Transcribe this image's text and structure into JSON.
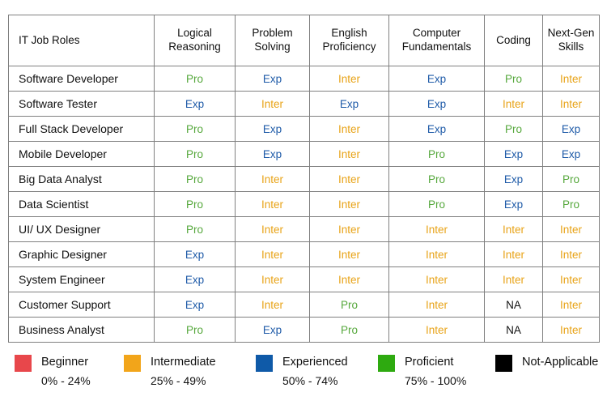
{
  "table": {
    "columns": [
      {
        "label": "IT Job Roles",
        "lines": [
          "IT Job Roles"
        ]
      },
      {
        "label": "Logical Reasoning",
        "lines": [
          "Logical",
          "Reasoning"
        ]
      },
      {
        "label": "Problem Solving",
        "lines": [
          "Problem",
          "Solving"
        ]
      },
      {
        "label": "English Proficiency",
        "lines": [
          "English",
          "Proficiency"
        ]
      },
      {
        "label": "Computer Fundamentals",
        "lines": [
          "Computer",
          "Fundamentals"
        ]
      },
      {
        "label": "Coding",
        "lines": [
          "Coding"
        ]
      },
      {
        "label": "Next-Gen Skills",
        "lines": [
          "Next-Gen",
          "Skills"
        ]
      }
    ],
    "rows": [
      {
        "role": "Software Developer",
        "values": [
          "Pro",
          "Exp",
          "Inter",
          "Exp",
          "Pro",
          "Inter"
        ]
      },
      {
        "role": "Software Tester",
        "values": [
          "Exp",
          "Inter",
          "Exp",
          "Exp",
          "Inter",
          "Inter"
        ]
      },
      {
        "role": "Full Stack Developer",
        "values": [
          "Pro",
          "Exp",
          "Inter",
          "Exp",
          "Pro",
          "Exp"
        ]
      },
      {
        "role": "Mobile Developer",
        "values": [
          "Pro",
          "Exp",
          "Inter",
          "Pro",
          "Exp",
          "Exp"
        ]
      },
      {
        "role": "Big Data Analyst",
        "values": [
          "Pro",
          "Inter",
          "Inter",
          "Pro",
          "Exp",
          "Pro"
        ]
      },
      {
        "role": "Data Scientist",
        "values": [
          "Pro",
          "Inter",
          "Inter",
          "Pro",
          "Exp",
          "Pro"
        ]
      },
      {
        "role": "UI/ UX Designer",
        "values": [
          "Pro",
          "Inter",
          "Inter",
          "Inter",
          "Inter",
          "Inter"
        ]
      },
      {
        "role": "Graphic Designer",
        "values": [
          "Exp",
          "Inter",
          "Inter",
          "Inter",
          "Inter",
          "Inter"
        ]
      },
      {
        "role": "System Engineer",
        "values": [
          "Exp",
          "Inter",
          "Inter",
          "Inter",
          "Inter",
          "Inter"
        ]
      },
      {
        "role": "Customer Support",
        "values": [
          "Exp",
          "Inter",
          "Pro",
          "Inter",
          "NA",
          "Inter"
        ]
      },
      {
        "role": "Business Analyst",
        "values": [
          "Pro",
          "Exp",
          "Pro",
          "Inter",
          "NA",
          "Inter"
        ]
      }
    ]
  },
  "legend": {
    "items": [
      {
        "label": "Beginner",
        "range": "0% - 24%",
        "color": "#e8474b"
      },
      {
        "label": "Intermediate",
        "range": "25% - 49%",
        "color": "#f2a51a"
      },
      {
        "label": "Experienced",
        "range": "50% - 74%",
        "color": "#0f5aa8"
      },
      {
        "label": "Proficient",
        "range": "75% - 100%",
        "color": "#2eaa10"
      },
      {
        "label": "Not-Applicable",
        "range": "",
        "color": "#000000"
      }
    ]
  },
  "value_colors": {
    "Pro": "#56a83c",
    "Exp": "#1f5ba8",
    "Inter": "#e8a317",
    "NA": "#111111"
  },
  "chart_data": {
    "type": "table",
    "title": "",
    "categories": [
      "Logical Reasoning",
      "Problem Solving",
      "English Proficiency",
      "Computer Fundamentals",
      "Coding",
      "Next-Gen Skills"
    ],
    "row_labels": [
      "Software Developer",
      "Software Tester",
      "Full Stack Developer",
      "Mobile Developer",
      "Big Data Analyst",
      "Data Scientist",
      "UI/ UX Designer",
      "Graphic Designer",
      "System Engineer",
      "Customer Support",
      "Business Analyst"
    ],
    "cells": [
      [
        "Pro",
        "Exp",
        "Inter",
        "Exp",
        "Pro",
        "Inter"
      ],
      [
        "Exp",
        "Inter",
        "Exp",
        "Exp",
        "Inter",
        "Inter"
      ],
      [
        "Pro",
        "Exp",
        "Inter",
        "Exp",
        "Pro",
        "Exp"
      ],
      [
        "Pro",
        "Exp",
        "Inter",
        "Pro",
        "Exp",
        "Exp"
      ],
      [
        "Pro",
        "Inter",
        "Inter",
        "Pro",
        "Exp",
        "Pro"
      ],
      [
        "Pro",
        "Inter",
        "Inter",
        "Pro",
        "Exp",
        "Pro"
      ],
      [
        "Pro",
        "Inter",
        "Inter",
        "Inter",
        "Inter",
        "Inter"
      ],
      [
        "Exp",
        "Inter",
        "Inter",
        "Inter",
        "Inter",
        "Inter"
      ],
      [
        "Exp",
        "Inter",
        "Inter",
        "Inter",
        "Inter",
        "Inter"
      ],
      [
        "Exp",
        "Inter",
        "Pro",
        "Inter",
        "NA",
        "Inter"
      ],
      [
        "Pro",
        "Exp",
        "Pro",
        "Inter",
        "NA",
        "Inter"
      ]
    ],
    "legend_entries": [
      {
        "code": "Beg",
        "label": "Beginner",
        "range": "0% - 24%"
      },
      {
        "code": "Inter",
        "label": "Intermediate",
        "range": "25% - 49%"
      },
      {
        "code": "Exp",
        "label": "Experienced",
        "range": "50% - 74%"
      },
      {
        "code": "Pro",
        "label": "Proficient",
        "range": "75% - 100%"
      },
      {
        "code": "NA",
        "label": "Not-Applicable",
        "range": ""
      }
    ],
    "grid": true,
    "legend_position": "bottom"
  }
}
